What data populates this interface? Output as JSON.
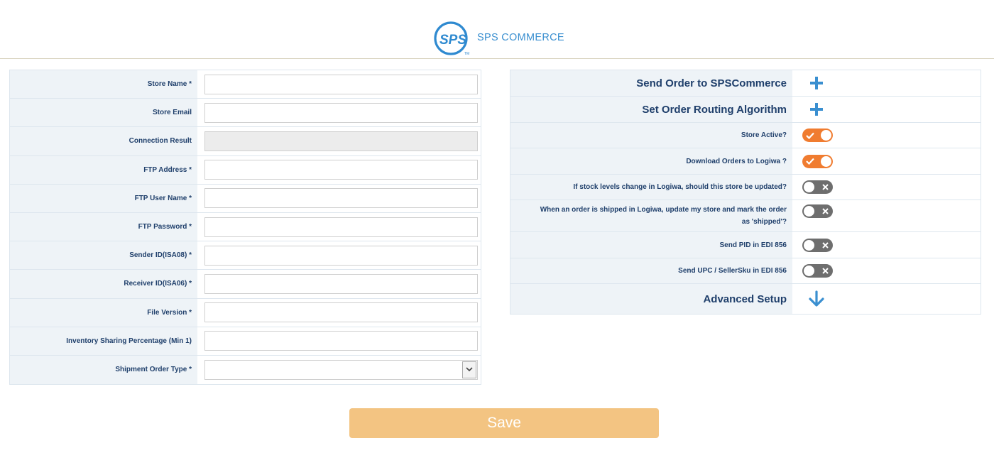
{
  "header": {
    "logo_text": "SPS COMMERCE",
    "logo_icon": "sps-logo-icon"
  },
  "form": {
    "fields": [
      {
        "label": "Store Name *",
        "value": "",
        "placeholder": ""
      },
      {
        "label": "Store Email",
        "value": "",
        "placeholder": ""
      },
      {
        "label": "Connection Result",
        "value": "",
        "placeholder": ""
      },
      {
        "label": "FTP Address *",
        "value": "",
        "placeholder": ""
      },
      {
        "label": "FTP User Name *",
        "value": "",
        "placeholder": ""
      },
      {
        "label": "FTP Password *",
        "value": "",
        "placeholder": ""
      },
      {
        "label": "Sender ID(ISA08) *",
        "value": "",
        "placeholder": ""
      },
      {
        "label": "Receiver ID(ISA06) *",
        "value": "",
        "placeholder": ""
      },
      {
        "label": "File Version *",
        "value": "",
        "placeholder": ""
      },
      {
        "label": "Inventory Sharing Percentage (Min 1)",
        "value": "",
        "placeholder": ""
      }
    ],
    "shipment_order_type": {
      "label": "Shipment Order Type *",
      "value": ""
    }
  },
  "settings": {
    "send_order": {
      "label": "Send Order to SPSCommerce",
      "icon": "plus-icon"
    },
    "routing": {
      "label": "Set Order Routing Algorithm",
      "icon": "plus-icon"
    },
    "toggles": [
      {
        "label": "Store Active?",
        "on": true
      },
      {
        "label": "Download Orders to Logiwa ?",
        "on": true
      },
      {
        "label": "If stock levels change in Logiwa, should this store be updated?",
        "on": false
      },
      {
        "label": "When an order is shipped in Logiwa, update my store and mark the order as 'shipped'?",
        "on": false
      },
      {
        "label": "Send PID in EDI 856",
        "on": false
      },
      {
        "label": "Send UPC / SellerSku in EDI 856",
        "on": false
      }
    ],
    "advanced": {
      "label": "Advanced Setup",
      "icon": "arrow-down-icon"
    }
  },
  "save_label": "Save",
  "colors": {
    "label_text": "#1f3f6b",
    "label_bg": "#eef3f7",
    "toggle_on": "#f07c30",
    "toggle_off": "#6e6e6e",
    "accent_blue": "#3a8fd0",
    "save_button": "#f3c482"
  }
}
